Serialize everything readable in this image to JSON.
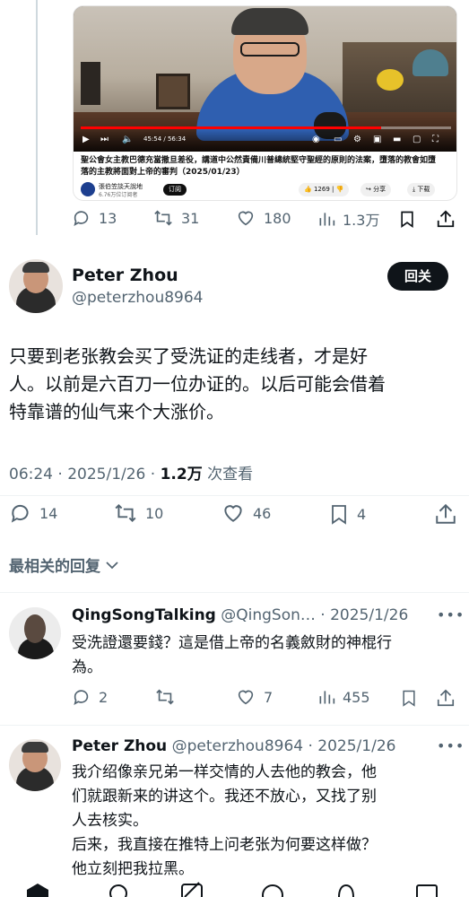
{
  "embedded_video": {
    "elapsed": "45:54 / 56:34",
    "progress": 0.81,
    "title_line1": "聖公會女主教巴德充當撒旦差役，講道中公然責備川普總統堅守聖經的原則的法案，墮落的教會如墮",
    "title_line2": "落的主教將面對上帝的審判（2025/01/23）",
    "channel_name": "張伯笠談天說地",
    "channel_subs": "6.76万位订阅者",
    "subscribe_label": "订阅",
    "like_count": "1269",
    "share_label": "分享",
    "download_label": "下载"
  },
  "top_actions": {
    "replies": "13",
    "retweets": "31",
    "likes": "180",
    "views": "1.3万"
  },
  "main_tweet": {
    "name": "Peter Zhou",
    "handle": "@peterzhou8964",
    "follow_label": "回关",
    "text_line1": "只要到老张教会买了受洗证的走线者，才是好",
    "text_line2": "人。以前是六百刀一位办证的。以后可能会借着",
    "text_line3": "特靠谱的仙气来个大涨价。",
    "time_date": "06:24 · 2025/1/26 · ",
    "view_count": "1.2万",
    "view_suffix": " 次查看",
    "replies": "14",
    "retweets": "10",
    "likes": "46",
    "bookmarks": "4"
  },
  "sort_label": "最相关的回复",
  "replies": [
    {
      "name": "QingSongTalking",
      "handle_date": " @QingSon… · 2025/1/26",
      "text_line1": "受洗證還要錢？這是借上帝的名義斂財的神棍行",
      "text_line2": "為。",
      "replies": "2",
      "likes": "7",
      "views": "455"
    },
    {
      "name": "Peter Zhou",
      "handle_date": " @peterzhou8964 · 2025/1/26",
      "text_line1": "我介绍像亲兄弟一样交情的人去他的教会，他",
      "text_line2": "们就跟新来的讲这个。我还不放心，又找了别",
      "text_line3": "人去核实。",
      "text_line4": "后来，我直接在推特上问老张为何要这样做？",
      "text_line5": "他立刻把我拉黑。"
    }
  ],
  "more_glyph": "•••"
}
